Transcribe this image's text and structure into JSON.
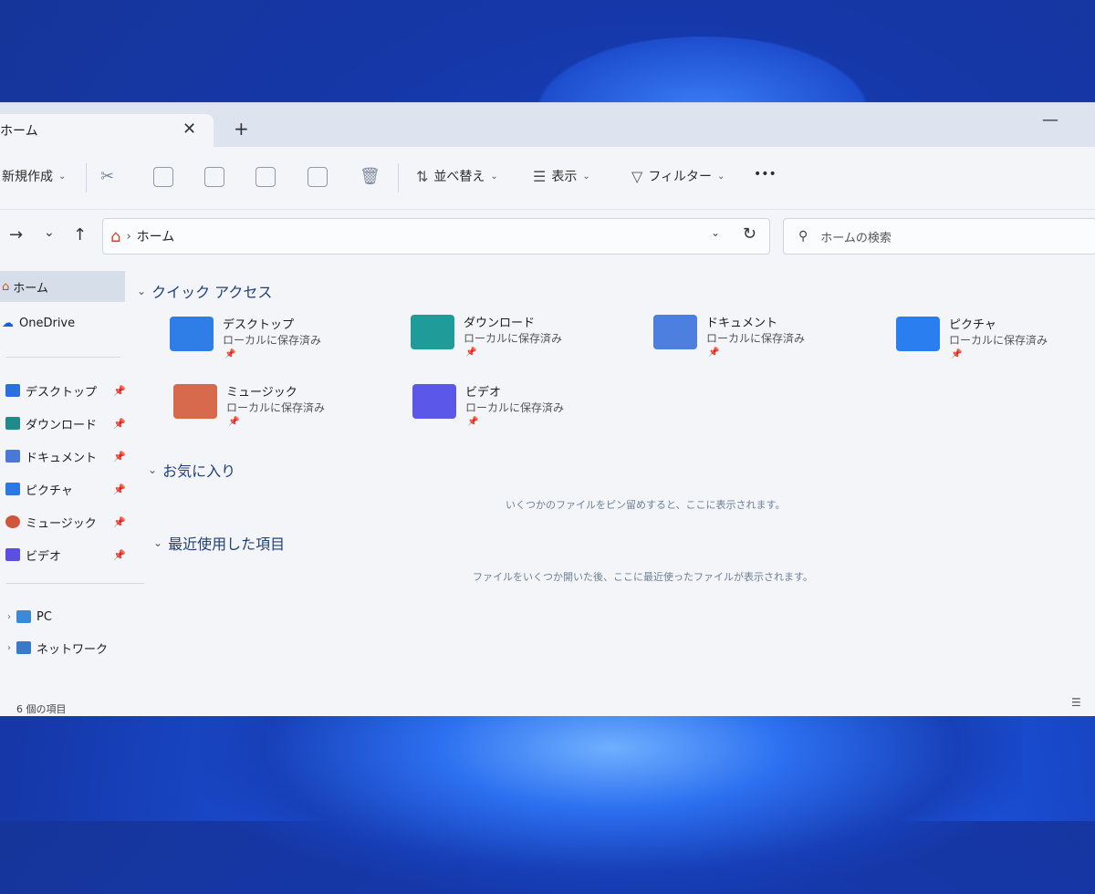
{
  "titlebar": {
    "tab_title": "ホーム",
    "close": "✕",
    "add": "+",
    "minimize": "—"
  },
  "toolbar": {
    "new_label": "新規作成",
    "sort_label": "並べ替え",
    "view_label": "表示",
    "filter_label": "フィルター",
    "more_label": "•••"
  },
  "nav": {
    "forward": "→",
    "recent": "⌄",
    "up": "↑",
    "address_home_icon": "home-icon",
    "address_text": "ホーム",
    "search_placeholder": "ホームの検索"
  },
  "sidebar": {
    "home": "ホーム",
    "onedrive": "OneDrive",
    "pinned": [
      {
        "label": "デスクトップ",
        "color": "#2a6fe0"
      },
      {
        "label": "ダウンロード",
        "color": "#1e8a8a"
      },
      {
        "label": "ドキュメント",
        "color": "#4b78d8"
      },
      {
        "label": "ピクチャ",
        "color": "#2c76e5"
      },
      {
        "label": "ミュージック",
        "color": "#d0553a"
      },
      {
        "label": "ビデオ",
        "color": "#5a4fe0"
      }
    ],
    "pc": "PC",
    "network": "ネットワーク"
  },
  "main": {
    "quick_access_heading": "クイック アクセス",
    "favorites_heading": "お気に入り",
    "favorites_empty": "いくつかのファイルをピン留めすると、ここに表示されます。",
    "recent_heading": "最近使用した項目",
    "recent_empty": "ファイルをいくつか開いた後、ここに最近使ったファイルが表示されます。",
    "quick_access": [
      {
        "name": "デスクトップ",
        "sub": "ローカルに保存済み",
        "color": "#2f7ee8"
      },
      {
        "name": "ダウンロード",
        "sub": "ローカルに保存済み",
        "color": "#1f9c9a"
      },
      {
        "name": "ドキュメント",
        "sub": "ローカルに保存済み",
        "color": "#4d7fe0"
      },
      {
        "name": "ピクチャ",
        "sub": "ローカルに保存済み",
        "color": "#2b7ef0"
      },
      {
        "name": "ミュージック",
        "sub": "ローカルに保存済み",
        "color": "#d76a4c"
      },
      {
        "name": "ビデオ",
        "sub": "ローカルに保存済み",
        "color": "#5b57e8"
      }
    ]
  },
  "status": {
    "item_count": "6 個の項目"
  }
}
